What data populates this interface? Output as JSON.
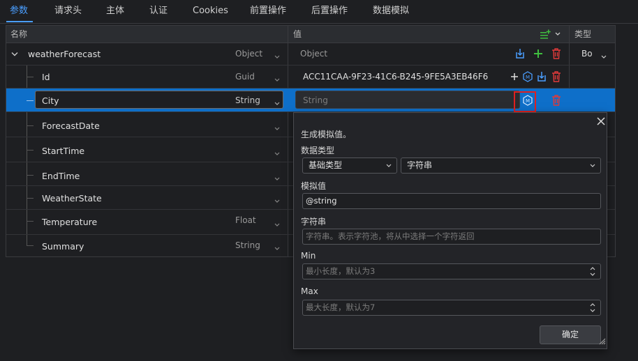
{
  "tabs": [
    "参数",
    "请求头",
    "主体",
    "认证",
    "Cookies",
    "前置操作",
    "后置操作",
    "数据模拟"
  ],
  "header": {
    "name": "名称",
    "value": "值",
    "type": "类型"
  },
  "rows": [
    {
      "name": "weatherForecast",
      "type": "Object",
      "value": "Object",
      "extra": "Bo"
    },
    {
      "name": "Id",
      "type": "Guid",
      "value": "ACC11CAA-9F23-41C6-B245-9FE5A3EB46F6"
    },
    {
      "name": "City",
      "type": "String",
      "value_placeholder": "String"
    },
    {
      "name": "ForecastDate",
      "type": ""
    },
    {
      "name": "StartTime",
      "type": ""
    },
    {
      "name": "EndTime",
      "type": ""
    },
    {
      "name": "WeatherState",
      "type": ""
    },
    {
      "name": "Temperature",
      "type": "Float"
    },
    {
      "name": "Summary",
      "type": "String"
    }
  ],
  "popup": {
    "title": "生成模拟值。",
    "data_type_label": "数据类型",
    "data_type_select": "基础类型",
    "data_subtype_select": "字符串",
    "mock_value_label": "模拟值",
    "mock_value": "@string",
    "string_label": "字符串",
    "string_placeholder": "字符串。表示字符池，将从中选择一个字符返回",
    "min_label": "Min",
    "min_placeholder": "最小长度，默认为3",
    "max_label": "Max",
    "max_placeholder": "最大长度，默认为7",
    "ok_label": "确定"
  },
  "colors": {
    "accent": "#4a9eff",
    "selected_row": "#0e6fc9",
    "add": "#3fbf3f",
    "delete": "#e03a3a",
    "highlight": "#e02020"
  }
}
